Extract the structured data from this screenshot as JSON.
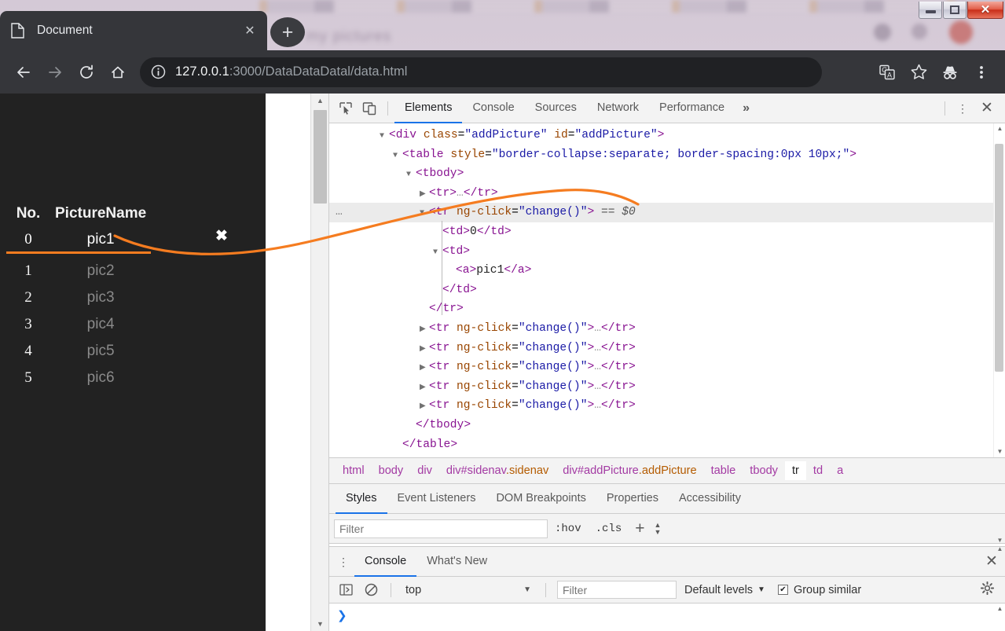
{
  "window": {
    "minimize_label": "—",
    "maximize_label": "☐",
    "close_label": "✕"
  },
  "browser": {
    "tab": {
      "title": "Document",
      "close_label": "✕",
      "favicon": "document-icon"
    },
    "new_tab_label": "+",
    "toolbar": {
      "back_label": "←",
      "forward_label": "→",
      "reload_label": "⟳",
      "home_label": "⌂",
      "url_host": "127.0.0.1",
      "url_rest": ":3000/DataDataDatal/data.html",
      "info_icon": "site-info-icon",
      "translate_icon": "translate-icon",
      "bookmark_icon": "star-icon",
      "incognito_icon": "incognito-icon",
      "menu_icon": "kebab-menu-icon"
    }
  },
  "page": {
    "sidenav": {
      "close_label": "✖",
      "table": {
        "headers": [
          "No.",
          "PictureName"
        ],
        "rows": [
          {
            "no": "0",
            "name": "pic1",
            "selected": true
          },
          {
            "no": "1",
            "name": "pic2",
            "selected": false
          },
          {
            "no": "2",
            "name": "pic3",
            "selected": false
          },
          {
            "no": "3",
            "name": "pic4",
            "selected": false
          },
          {
            "no": "4",
            "name": "pic5",
            "selected": false
          },
          {
            "no": "5",
            "name": "pic6",
            "selected": false
          }
        ]
      }
    }
  },
  "devtools": {
    "tabs": [
      {
        "label": "Elements",
        "active": true
      },
      {
        "label": "Console",
        "active": false
      },
      {
        "label": "Sources",
        "active": false
      },
      {
        "label": "Network",
        "active": false
      },
      {
        "label": "Performance",
        "active": false
      }
    ],
    "more_label": "»",
    "inspect_icon": "inspect-element-icon",
    "device_icon": "device-toolbar-icon",
    "kebab_label": "⋮",
    "close_label": "✕",
    "dom": {
      "lines": [
        {
          "indent": 2,
          "tri": "open",
          "html": "<span class=\"tk-punct\">&lt;</span><span class=\"tk-tag\">div</span> <span class=\"tk-attr\">class</span>=<span class=\"tk-val\">\"addPicture\"</span> <span class=\"tk-attr\">id</span>=<span class=\"tk-val\">\"addPicture\"</span><span class=\"tk-punct\">&gt;</span>"
        },
        {
          "indent": 3,
          "tri": "open",
          "html": "<span class=\"tk-punct\">&lt;</span><span class=\"tk-tag\">table</span> <span class=\"tk-attr\">style</span>=<span class=\"tk-val\">\"border-collapse:separate; border-spacing:0px 10px;\"</span><span class=\"tk-punct\">&gt;</span>"
        },
        {
          "indent": 4,
          "tri": "open",
          "html": "<span class=\"tk-punct\">&lt;</span><span class=\"tk-tag\">tbody</span><span class=\"tk-punct\">&gt;</span>"
        },
        {
          "indent": 5,
          "tri": "closed",
          "html": "<span class=\"tk-punct\">&lt;</span><span class=\"tk-tag\">tr</span><span class=\"tk-punct\">&gt;</span><span class=\"tk-grey\">…</span><span class=\"tk-punct\">&lt;/</span><span class=\"tk-tag\">tr</span><span class=\"tk-punct\">&gt;</span>"
        },
        {
          "indent": 5,
          "tri": "open",
          "selected": true,
          "gutter": "…",
          "html": "<span class=\"tk-punct\">&lt;</span><span class=\"tk-tag\">tr</span> <span class=\"tk-attr\">ng-click</span>=<span class=\"tk-val\">\"change()\"</span><span class=\"tk-punct\">&gt;</span> <span class=\"tk-dollar\">== $0</span>"
        },
        {
          "indent": 6,
          "tri": "none",
          "html": "<span class=\"tk-punct\">&lt;</span><span class=\"tk-tag\">td</span><span class=\"tk-punct\">&gt;</span><span class=\"tk-text\">0</span><span class=\"tk-punct\">&lt;/</span><span class=\"tk-tag\">td</span><span class=\"tk-punct\">&gt;</span>"
        },
        {
          "indent": 6,
          "tri": "open",
          "html": "<span class=\"tk-punct\">&lt;</span><span class=\"tk-tag\">td</span><span class=\"tk-punct\">&gt;</span>"
        },
        {
          "indent": 7,
          "tri": "none",
          "html": "<span class=\"tk-punct\">&lt;</span><span class=\"tk-tag\">a</span><span class=\"tk-punct\">&gt;</span><span class=\"tk-text\">pic1</span><span class=\"tk-punct\">&lt;/</span><span class=\"tk-tag\">a</span><span class=\"tk-punct\">&gt;</span>"
        },
        {
          "indent": 6,
          "tri": "none",
          "html": "<span class=\"tk-punct\">&lt;/</span><span class=\"tk-tag\">td</span><span class=\"tk-punct\">&gt;</span>"
        },
        {
          "indent": 5,
          "tri": "none",
          "html": "<span class=\"tk-punct\">&lt;/</span><span class=\"tk-tag\">tr</span><span class=\"tk-punct\">&gt;</span>"
        },
        {
          "indent": 5,
          "tri": "closed",
          "html": "<span class=\"tk-punct\">&lt;</span><span class=\"tk-tag\">tr</span> <span class=\"tk-attr\">ng-click</span>=<span class=\"tk-val\">\"change()\"</span><span class=\"tk-punct\">&gt;</span><span class=\"tk-grey\">…</span><span class=\"tk-punct\">&lt;/</span><span class=\"tk-tag\">tr</span><span class=\"tk-punct\">&gt;</span>"
        },
        {
          "indent": 5,
          "tri": "closed",
          "html": "<span class=\"tk-punct\">&lt;</span><span class=\"tk-tag\">tr</span> <span class=\"tk-attr\">ng-click</span>=<span class=\"tk-val\">\"change()\"</span><span class=\"tk-punct\">&gt;</span><span class=\"tk-grey\">…</span><span class=\"tk-punct\">&lt;/</span><span class=\"tk-tag\">tr</span><span class=\"tk-punct\">&gt;</span>"
        },
        {
          "indent": 5,
          "tri": "closed",
          "html": "<span class=\"tk-punct\">&lt;</span><span class=\"tk-tag\">tr</span> <span class=\"tk-attr\">ng-click</span>=<span class=\"tk-val\">\"change()\"</span><span class=\"tk-punct\">&gt;</span><span class=\"tk-grey\">…</span><span class=\"tk-punct\">&lt;/</span><span class=\"tk-tag\">tr</span><span class=\"tk-punct\">&gt;</span>"
        },
        {
          "indent": 5,
          "tri": "closed",
          "html": "<span class=\"tk-punct\">&lt;</span><span class=\"tk-tag\">tr</span> <span class=\"tk-attr\">ng-click</span>=<span class=\"tk-val\">\"change()\"</span><span class=\"tk-punct\">&gt;</span><span class=\"tk-grey\">…</span><span class=\"tk-punct\">&lt;/</span><span class=\"tk-tag\">tr</span><span class=\"tk-punct\">&gt;</span>"
        },
        {
          "indent": 5,
          "tri": "closed",
          "html": "<span class=\"tk-punct\">&lt;</span><span class=\"tk-tag\">tr</span> <span class=\"tk-attr\">ng-click</span>=<span class=\"tk-val\">\"change()\"</span><span class=\"tk-punct\">&gt;</span><span class=\"tk-grey\">…</span><span class=\"tk-punct\">&lt;/</span><span class=\"tk-tag\">tr</span><span class=\"tk-punct\">&gt;</span>"
        },
        {
          "indent": 4,
          "tri": "none",
          "html": "<span class=\"tk-punct\">&lt;/</span><span class=\"tk-tag\">tbody</span><span class=\"tk-punct\">&gt;</span>"
        },
        {
          "indent": 3,
          "tri": "none",
          "html": "<span class=\"tk-punct\">&lt;/</span><span class=\"tk-tag\">table</span><span class=\"tk-punct\">&gt;</span>"
        }
      ]
    },
    "breadcrumb": [
      {
        "tag": "html",
        "cls": "",
        "active": false
      },
      {
        "tag": "body",
        "cls": "",
        "active": false
      },
      {
        "tag": "div",
        "cls": "",
        "active": false
      },
      {
        "tag": "div#sidenav",
        "cls": ".sidenav",
        "active": false
      },
      {
        "tag": "div#addPicture",
        "cls": ".addPicture",
        "active": false
      },
      {
        "tag": "table",
        "cls": "",
        "active": false
      },
      {
        "tag": "tbody",
        "cls": "",
        "active": false
      },
      {
        "tag": "tr",
        "cls": "",
        "active": true
      },
      {
        "tag": "td",
        "cls": "",
        "active": false
      },
      {
        "tag": "a",
        "cls": "",
        "active": false
      }
    ],
    "styles": {
      "tabs": [
        {
          "label": "Styles",
          "active": true
        },
        {
          "label": "Event Listeners",
          "active": false
        },
        {
          "label": "DOM Breakpoints",
          "active": false
        },
        {
          "label": "Properties",
          "active": false
        },
        {
          "label": "Accessibility",
          "active": false
        }
      ],
      "filter_placeholder": "Filter",
      "filter_value": "",
      "hov_label": ":hov",
      "cls_label": ".cls",
      "new_rule_label": "+"
    },
    "drawer": {
      "kebab_label": "⋮",
      "tabs": [
        {
          "label": "Console",
          "active": true
        },
        {
          "label": "What's New",
          "active": false
        }
      ],
      "close_label": "✕",
      "sidebar_icon": "console-sidebar-icon",
      "clear_icon": "clear-console-icon",
      "context": "top",
      "filter_placeholder": "Filter",
      "filter_value": "",
      "levels_label": "Default levels",
      "group_similar_label": "Group similar",
      "group_similar_checked": true,
      "settings_icon": "gear-icon",
      "prompt_symbol": "❯"
    }
  },
  "annotation": {
    "color": "#f57c20",
    "description": "hand-drawn-curve"
  }
}
